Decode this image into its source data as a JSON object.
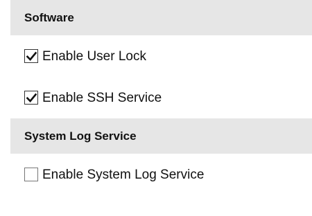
{
  "sections": [
    {
      "title": "Software",
      "options": [
        {
          "label": "Enable User Lock",
          "checked": true
        },
        {
          "label": "Enable SSH Service",
          "checked": true
        }
      ]
    },
    {
      "title": "System Log Service",
      "options": [
        {
          "label": "Enable System Log Service",
          "checked": false
        }
      ]
    }
  ],
  "icons": {
    "checked": "checkmark-icon"
  },
  "colors": {
    "header_bg": "#e6e6e6",
    "text": "#111111",
    "checkbox_border": "#333333"
  }
}
